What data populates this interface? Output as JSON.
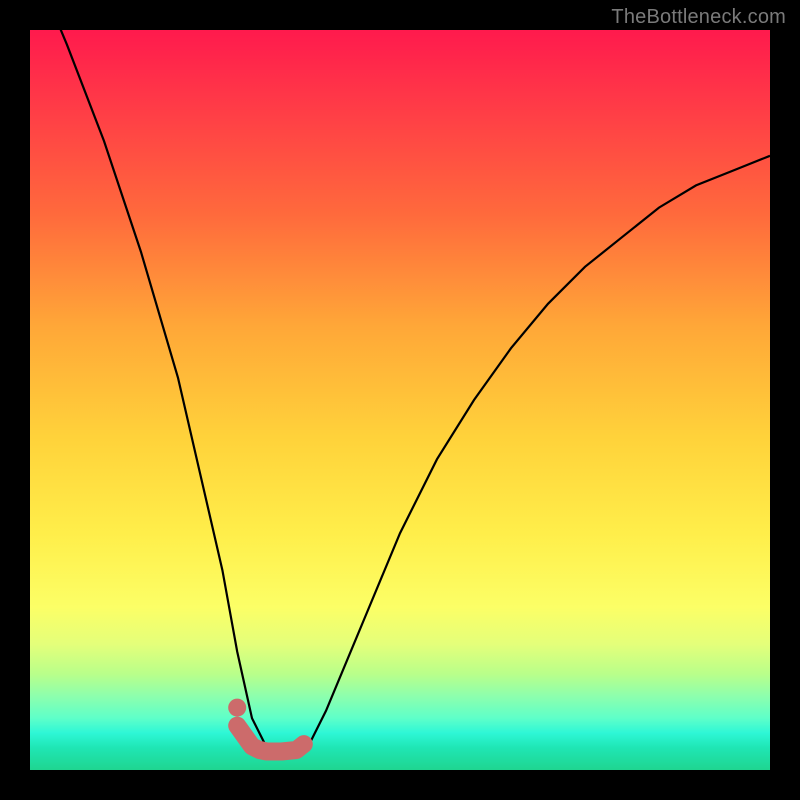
{
  "watermark": "TheBottleneck.com",
  "colors": {
    "frame": "#000000",
    "curve": "#000000",
    "marker": "#cc6b6b"
  },
  "chart_data": {
    "type": "line",
    "title": "",
    "xlabel": "",
    "ylabel": "",
    "xlim": [
      0,
      100
    ],
    "ylim": [
      0,
      100
    ],
    "series": [
      {
        "name": "bottleneck-curve",
        "x": [
          0,
          5,
          10,
          15,
          20,
          23,
          26,
          28,
          30,
          32,
          34,
          36,
          38,
          40,
          45,
          50,
          55,
          60,
          65,
          70,
          75,
          80,
          85,
          90,
          95,
          100
        ],
        "y": [
          110,
          98,
          85,
          70,
          53,
          40,
          27,
          16,
          7,
          3,
          2,
          2,
          4,
          8,
          20,
          32,
          42,
          50,
          57,
          63,
          68,
          72,
          76,
          79,
          81,
          83
        ]
      }
    ],
    "markers": {
      "name": "highlight-segment",
      "x": [
        28,
        30,
        31,
        32,
        34,
        36,
        37
      ],
      "y": [
        6,
        3.2,
        2.7,
        2.5,
        2.5,
        2.7,
        3.5
      ]
    },
    "background_gradient_stops": [
      {
        "pct": 0,
        "color": "#ff1a4d"
      },
      {
        "pct": 25,
        "color": "#ff6a3c"
      },
      {
        "pct": 55,
        "color": "#ffd23a"
      },
      {
        "pct": 78,
        "color": "#fcff66"
      },
      {
        "pct": 90,
        "color": "#8dffad"
      },
      {
        "pct": 100,
        "color": "#1fd590"
      }
    ]
  }
}
